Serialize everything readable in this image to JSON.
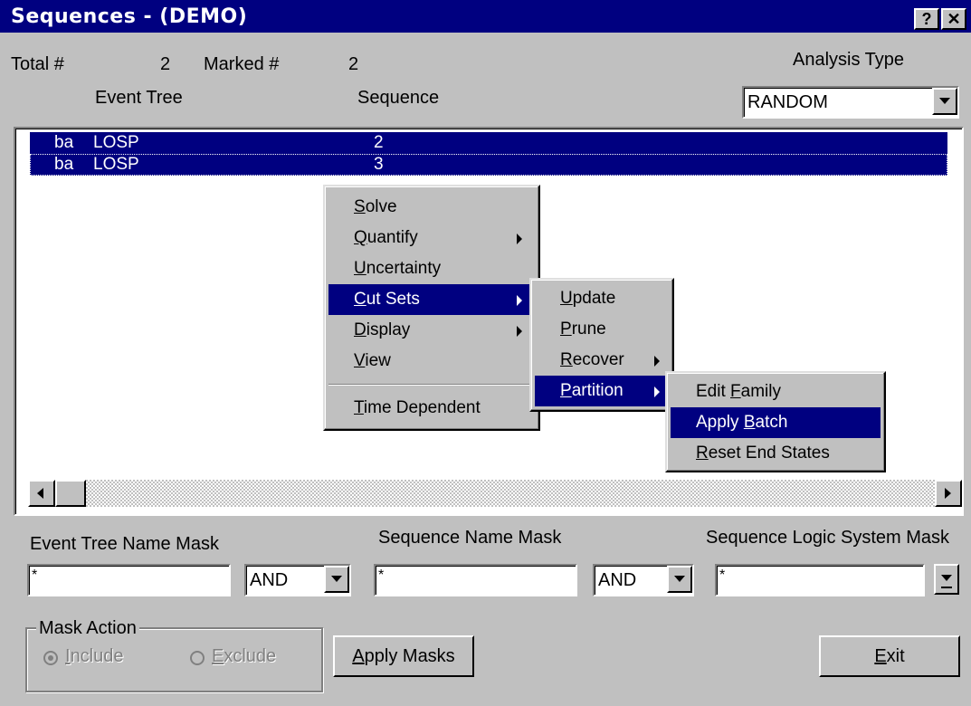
{
  "window": {
    "title": "Sequences  -  (DEMO)",
    "help_label": "?",
    "close_label": "✕"
  },
  "header": {
    "total_label": "Total #",
    "total_value": "2",
    "marked_label": "Marked #",
    "marked_value": "2",
    "col_event_tree": "Event Tree",
    "col_sequence": "Sequence",
    "analysis_type_label": "Analysis Type",
    "analysis_type_value": "RANDOM"
  },
  "list": {
    "rows": [
      {
        "prefix": "ba",
        "tree": "LOSP",
        "seq": "2"
      },
      {
        "prefix": "ba",
        "tree": "LOSP",
        "seq": "3"
      }
    ]
  },
  "context_menu": {
    "items": [
      {
        "label_pre": "",
        "mnemonic": "S",
        "label_post": "olve"
      },
      {
        "label_pre": "",
        "mnemonic": "Q",
        "label_post": "uantify"
      },
      {
        "label_pre": "",
        "mnemonic": "U",
        "label_post": "ncertainty"
      },
      {
        "label_pre": "",
        "mnemonic": "C",
        "label_post": "ut Sets"
      },
      {
        "label_pre": "",
        "mnemonic": "D",
        "label_post": "isplay"
      },
      {
        "label_pre": "",
        "mnemonic": "V",
        "label_post": "iew"
      },
      {
        "label_pre": "",
        "mnemonic": "T",
        "label_post": "ime Dependent"
      }
    ]
  },
  "cutsets_menu": {
    "items": [
      {
        "label_pre": "",
        "mnemonic": "U",
        "label_post": "pdate"
      },
      {
        "label_pre": "",
        "mnemonic": "P",
        "label_post": "rune"
      },
      {
        "label_pre": "",
        "mnemonic": "R",
        "label_post": "ecover"
      },
      {
        "label_pre": "",
        "mnemonic": "P",
        "label_post": "artition"
      }
    ]
  },
  "partition_menu": {
    "items": [
      {
        "label_pre": "Edit ",
        "mnemonic": "F",
        "label_post": "amily"
      },
      {
        "label_pre": "Apply ",
        "mnemonic": "B",
        "label_post": "atch"
      },
      {
        "label_pre": "",
        "mnemonic": "R",
        "label_post": "eset End States"
      }
    ]
  },
  "masks": {
    "event_tree_label": "Event Tree Name Mask",
    "event_tree_value": "*",
    "op1": "AND",
    "sequence_label": "Sequence Name Mask",
    "sequence_value": "*",
    "op2": "AND",
    "logic_label": "Sequence Logic System Mask",
    "logic_value": "*"
  },
  "mask_action": {
    "group_label": "Mask Action",
    "include_mnemonic": "I",
    "include_rest": "nclude",
    "exclude_mnemonic": "E",
    "exclude_rest": "xclude"
  },
  "buttons": {
    "apply_mnemonic": "A",
    "apply_rest": "pply Masks",
    "exit_mnemonic": "E",
    "exit_rest": "xit"
  },
  "colors": {
    "titlebar": "#000080",
    "face": "#c0c0c0",
    "selection": "#000080"
  }
}
